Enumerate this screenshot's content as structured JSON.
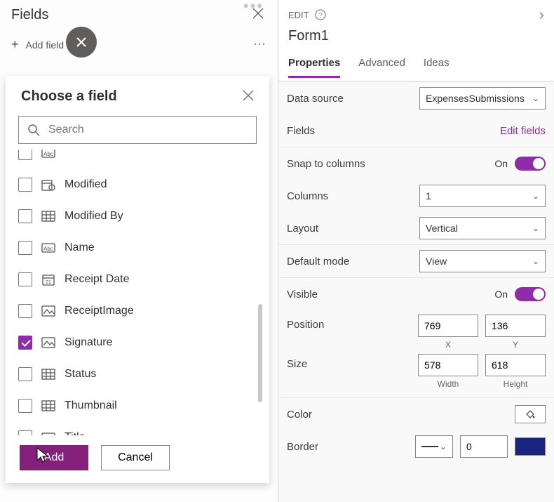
{
  "left": {
    "header_title": "Fields",
    "add_field_label": "Add field",
    "flyout": {
      "title": "Choose a field",
      "search_placeholder": "Search",
      "items": [
        {
          "label": "",
          "type": "text",
          "checked": false
        },
        {
          "label": "Modified",
          "type": "date-time",
          "checked": false
        },
        {
          "label": "Modified By",
          "type": "table",
          "checked": false
        },
        {
          "label": "Name",
          "type": "text",
          "checked": false
        },
        {
          "label": "Receipt Date",
          "type": "calendar-date",
          "checked": false
        },
        {
          "label": "ReceiptImage",
          "type": "image",
          "checked": false
        },
        {
          "label": "Signature",
          "type": "image",
          "checked": true
        },
        {
          "label": "Status",
          "type": "table",
          "checked": false
        },
        {
          "label": "Thumbnail",
          "type": "table",
          "checked": false
        },
        {
          "label": "Title",
          "type": "text",
          "checked": false
        }
      ],
      "add_button": "Add",
      "cancel_button": "Cancel"
    }
  },
  "right": {
    "edit_label": "EDIT",
    "form_name": "Form1",
    "tabs": {
      "properties": "Properties",
      "advanced": "Advanced",
      "ideas": "Ideas"
    },
    "data_source": {
      "label": "Data source",
      "value": "ExpensesSubmissions"
    },
    "fields": {
      "label": "Fields",
      "link": "Edit fields"
    },
    "snap": {
      "label": "Snap to columns",
      "state": "On"
    },
    "columns": {
      "label": "Columns",
      "value": "1"
    },
    "layout": {
      "label": "Layout",
      "value": "Vertical"
    },
    "default_mode": {
      "label": "Default mode",
      "value": "View"
    },
    "visible": {
      "label": "Visible",
      "state": "On"
    },
    "position": {
      "label": "Position",
      "x": "769",
      "y": "136",
      "xlabel": "X",
      "ylabel": "Y"
    },
    "size": {
      "label": "Size",
      "w": "578",
      "h": "618",
      "wlabel": "Width",
      "hlabel": "Height"
    },
    "color": {
      "label": "Color"
    },
    "border": {
      "label": "Border",
      "value": "0"
    }
  },
  "colors": {
    "accent": "#8e2da7",
    "border_fill": "#1a237e"
  }
}
